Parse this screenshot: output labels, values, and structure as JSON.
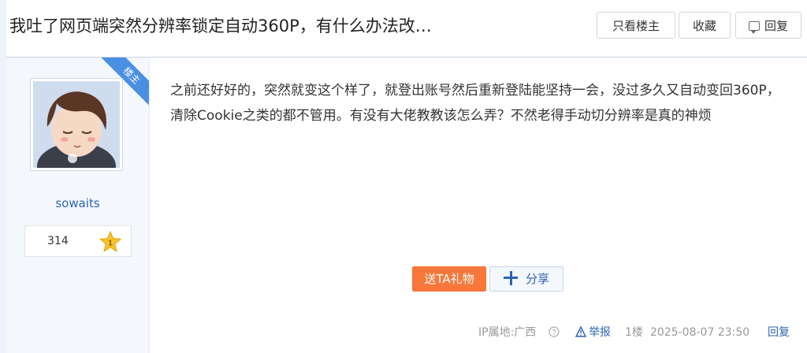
{
  "header": {
    "title": "我吐了网页端突然分辨率锁定自动360P，有什么办法改…",
    "only_author_label": "只看楼主",
    "favorite_label": "收藏",
    "reply_label": "回复"
  },
  "author": {
    "badge": "楼主",
    "username": "sowaits",
    "level_value": "314",
    "level_rank": "1"
  },
  "post": {
    "content": "之前还好好的，突然就变这个样了，就登出账号然后重新登陆能坚持一会，没过多久又自动变回360P，清除Cookie之类的都不管用。有没有大佬教教该怎么弄？不然老得手动切分辨率是真的神烦"
  },
  "actions": {
    "gift_label": "送TA礼物",
    "share_label": "分享"
  },
  "footer": {
    "ip_location": "IP属地:广西",
    "report_label": "举报",
    "floor": "1楼",
    "timestamp": "2025-08-07 23:50",
    "reply_label": "回复"
  },
  "colors": {
    "link_blue": "#2d64b3",
    "badge_blue": "#4a90e2",
    "gift_orange": "#f8773a",
    "star_gold": "#f5c22b"
  }
}
